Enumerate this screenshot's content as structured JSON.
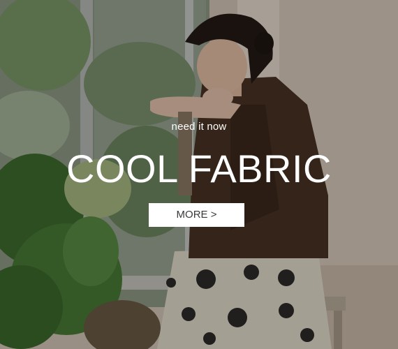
{
  "banner": {
    "tagline": "need it now",
    "headline": "COOL FABRIC",
    "button_label": "MORE >"
  },
  "colors": {
    "text": "#ffffff",
    "button_bg": "#ffffff",
    "button_text": "#3a3a3a",
    "blouse": "#4a3222",
    "skirt": "#e6e0cf",
    "foliage": "#4f7d3c",
    "wall": "#d8cbbd"
  }
}
